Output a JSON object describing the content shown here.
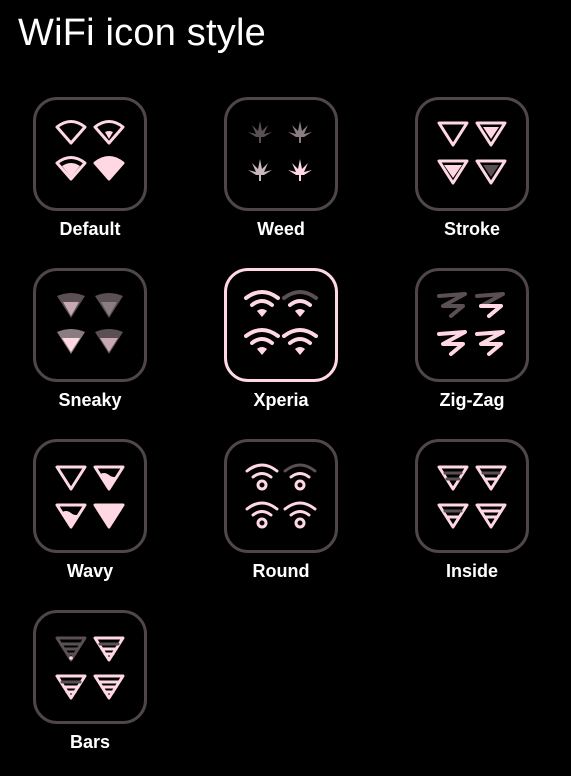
{
  "header": {
    "title": "WiFi icon style"
  },
  "colors": {
    "background": "#000000",
    "tile_border": "#4f4649",
    "tile_border_selected": "#ffd8e4",
    "icon_fill": "#ffd8e4",
    "icon_dim": "#5a4f53",
    "text": "#ffffff"
  },
  "styles": [
    {
      "label": "Default",
      "icon": "wifi-wedge-icon",
      "selected": false
    },
    {
      "label": "Weed",
      "icon": "leaf-icon",
      "selected": false
    },
    {
      "label": "Stroke",
      "icon": "triangle-outline-icon",
      "selected": false
    },
    {
      "label": "Sneaky",
      "icon": "faded-triangle-icon",
      "selected": false
    },
    {
      "label": "Xperia",
      "icon": "wifi-arcs-icon",
      "selected": true
    },
    {
      "label": "Zig-Zag",
      "icon": "zigzag-icon",
      "selected": false
    },
    {
      "label": "Wavy",
      "icon": "wavy-triangle-icon",
      "selected": false
    },
    {
      "label": "Round",
      "icon": "wifi-round-icon",
      "selected": false
    },
    {
      "label": "Inside",
      "icon": "inside-triangle-icon",
      "selected": false
    },
    {
      "label": "Bars",
      "icon": "bars-triangle-icon",
      "selected": false
    }
  ]
}
